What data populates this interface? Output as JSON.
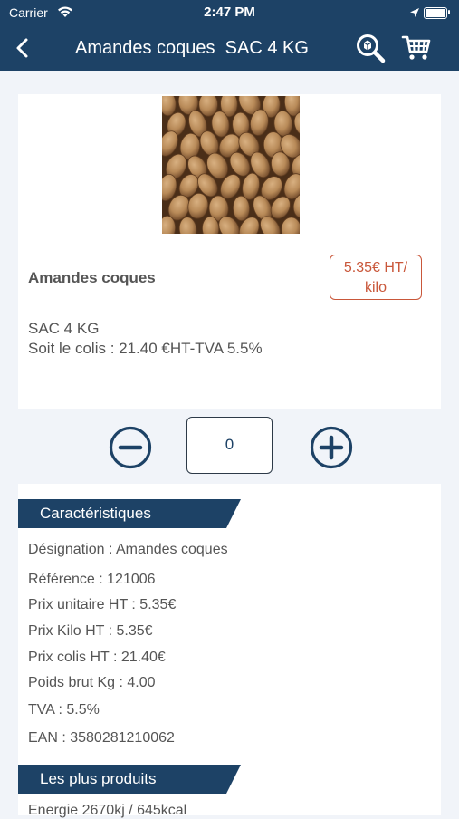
{
  "status_bar": {
    "carrier": "Carrier",
    "time": "2:47 PM"
  },
  "nav": {
    "title": "Amandes coques  SAC 4 KG"
  },
  "product": {
    "name": "Amandes coques",
    "price_line1": "5.35€ HT/",
    "price_line2": "kilo",
    "pack": "SAC 4 KG",
    "colis": "Soit le colis : 21.40 €HT-TVA 5.5%"
  },
  "quantity": {
    "value": "0"
  },
  "characteristics": {
    "header": "Caractéristiques",
    "rows": [
      "Désignation : Amandes coques",
      "Référence : 121006",
      "Prix unitaire HT : 5.35€",
      "Prix Kilo HT : 5.35€",
      "Prix colis HT : 21.40€",
      "Poids brut Kg : 4.00",
      "TVA : 5.5%",
      "EAN : 3580281210062"
    ]
  },
  "highlights": {
    "header": "Les plus produits",
    "rows": [
      "Energie 2670kj / 645kcal"
    ]
  },
  "colors": {
    "brand": "#1d4266",
    "price": "#c9573a",
    "background": "#f1f4f9"
  },
  "icons": [
    "wifi-icon",
    "location-arrow-icon",
    "battery-icon",
    "back-chevron-icon",
    "search-magnifier-icon",
    "cart-icon",
    "minus-circle-icon",
    "plus-circle-icon"
  ]
}
